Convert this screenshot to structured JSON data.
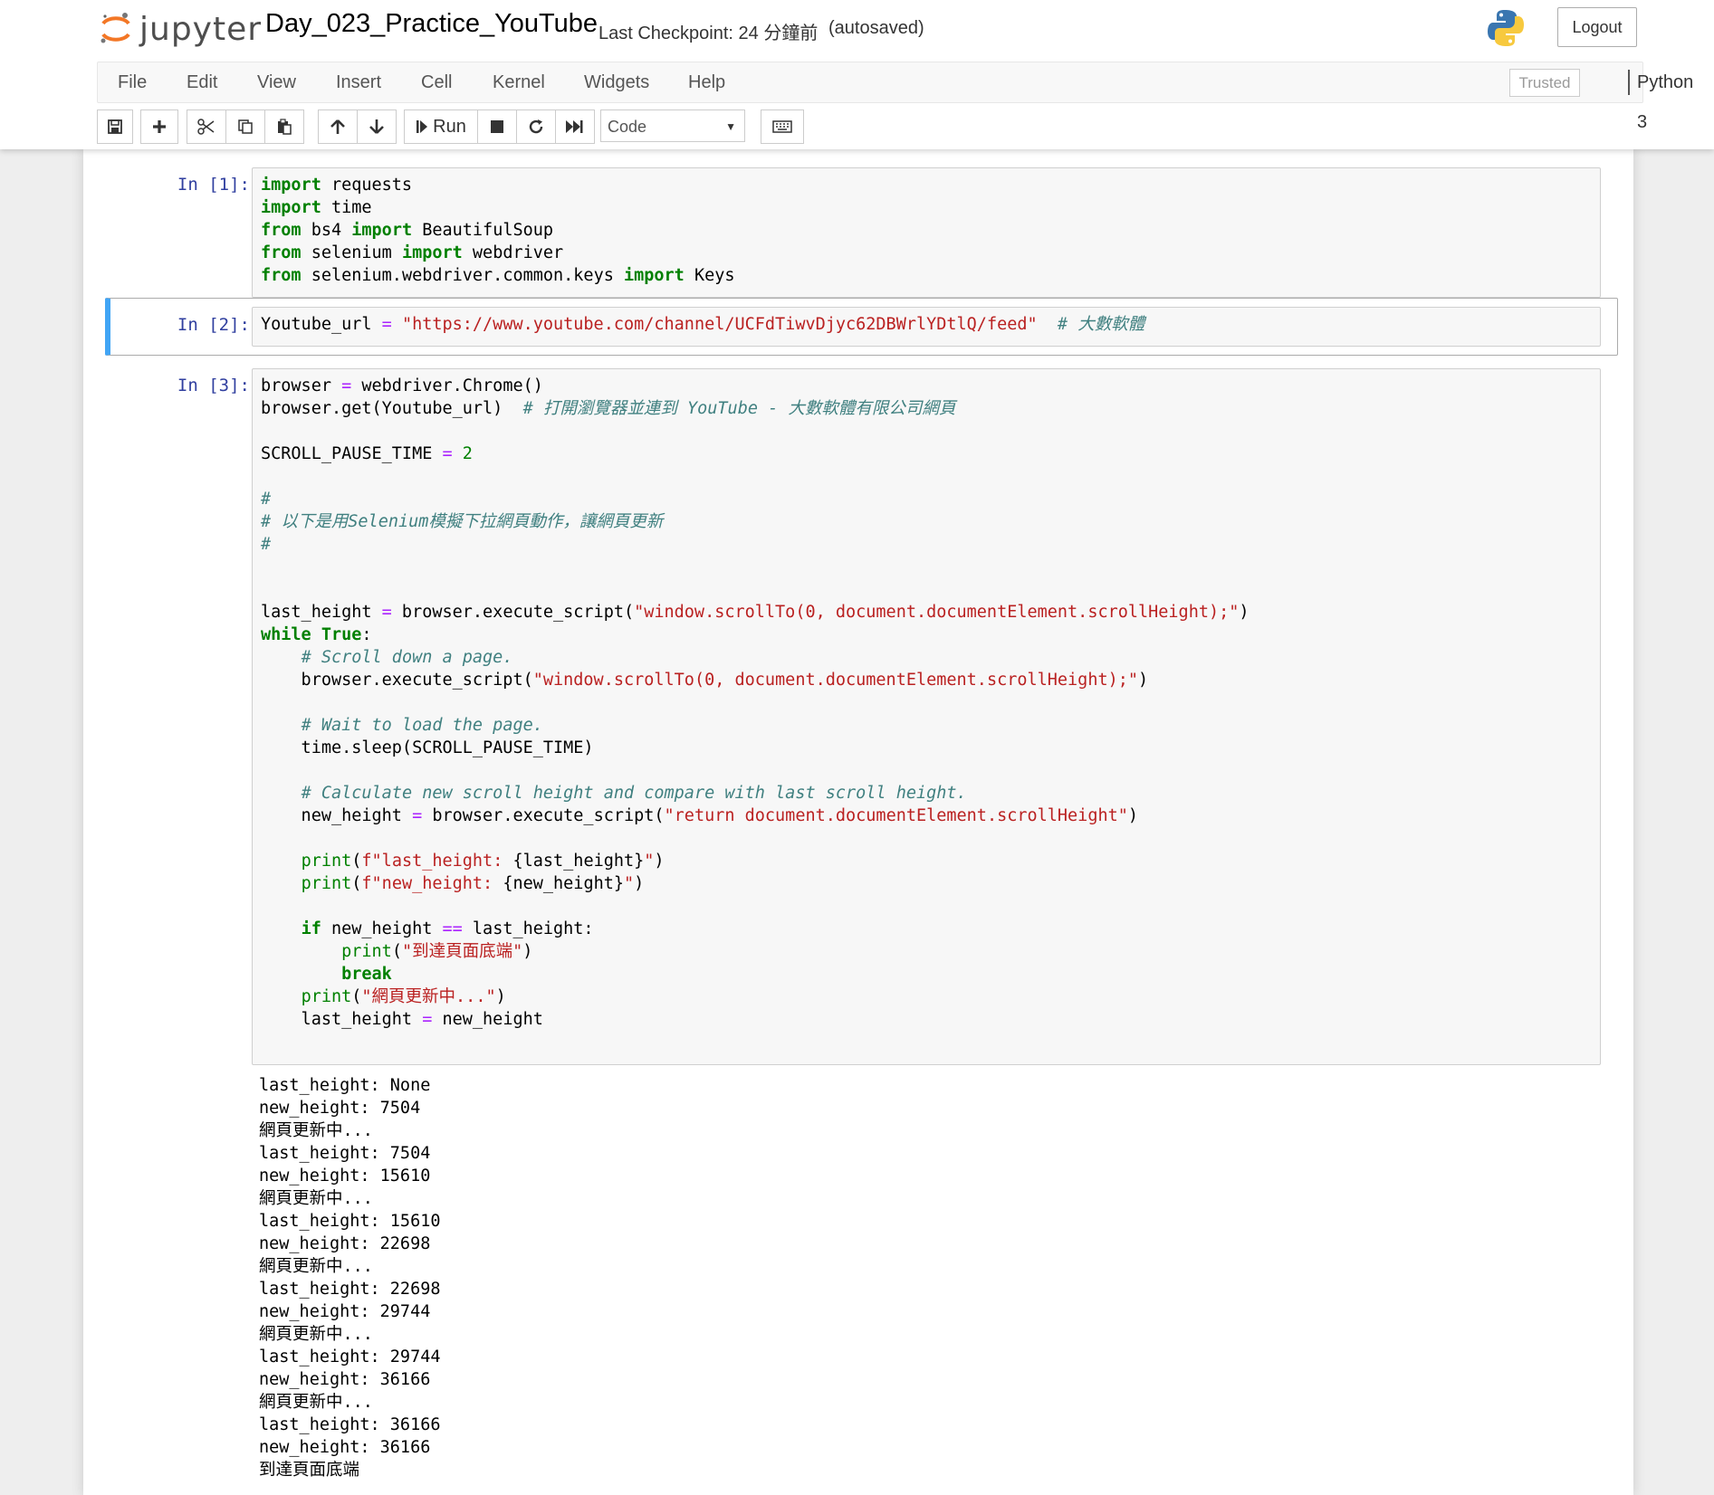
{
  "header": {
    "logo_text": "jupyter",
    "notebook_title": "Day_023_Practice_YouTube",
    "checkpoint": "Last Checkpoint: 24 分鐘前",
    "autosave": "(autosaved)",
    "logout_label": "Logout"
  },
  "menu": {
    "items": [
      "File",
      "Edit",
      "View",
      "Insert",
      "Cell",
      "Kernel",
      "Widgets",
      "Help"
    ],
    "trusted": "Trusted",
    "kernel_name": "Python 3"
  },
  "toolbar": {
    "run_label": "Run",
    "cell_type": "Code",
    "icons": [
      "save-icon",
      "plus-icon",
      "scissors-icon",
      "copy-icon",
      "paste-icon",
      "arrow-up-icon",
      "arrow-down-icon",
      "step-forward-icon",
      "stop-icon",
      "refresh-icon",
      "fast-forward-icon",
      "keyboard-icon"
    ]
  },
  "cells": [
    {
      "prompt": "In [1]:",
      "lines": [
        [
          [
            "kw",
            "import"
          ],
          [
            "",
            " requests"
          ]
        ],
        [
          [
            "kw",
            "import"
          ],
          [
            "",
            " time"
          ]
        ],
        [
          [
            "kw",
            "from"
          ],
          [
            "",
            " bs4 "
          ],
          [
            "kw",
            "import"
          ],
          [
            "",
            " BeautifulSoup"
          ]
        ],
        [
          [
            "kw",
            "from"
          ],
          [
            "",
            " selenium "
          ],
          [
            "kw",
            "import"
          ],
          [
            "",
            " webdriver"
          ]
        ],
        [
          [
            "kw",
            "from"
          ],
          [
            "",
            " selenium.webdriver.common.keys "
          ],
          [
            "kw",
            "import"
          ],
          [
            "",
            " Keys"
          ]
        ]
      ]
    },
    {
      "prompt": "In [2]:",
      "lines": [
        [
          [
            "",
            "Youtube_url "
          ],
          [
            "op",
            "="
          ],
          [
            "",
            " "
          ],
          [
            "str",
            "\"https://www.youtube.com/channel/UCFdTiwvDjyc62DBWrlYDtlQ/feed\""
          ],
          [
            "",
            "  "
          ],
          [
            "cm",
            "# 大數軟體"
          ]
        ]
      ]
    },
    {
      "prompt": "In [3]:",
      "lines": [
        [
          [
            "",
            "browser "
          ],
          [
            "op",
            "="
          ],
          [
            "",
            " webdriver.Chrome()"
          ]
        ],
        [
          [
            "",
            "browser.get(Youtube_url)  "
          ],
          [
            "cm",
            "# 打開瀏覽器並連到 YouTube - 大數軟體有限公司網頁"
          ]
        ],
        [],
        [
          [
            "",
            "SCROLL_PAUSE_TIME "
          ],
          [
            "op",
            "="
          ],
          [
            "",
            " "
          ],
          [
            "num",
            "2"
          ]
        ],
        [],
        [
          [
            "cm",
            "#"
          ]
        ],
        [
          [
            "cm",
            "# 以下是用Selenium模擬下拉網頁動作，讓網頁更新"
          ]
        ],
        [
          [
            "cm",
            "#"
          ]
        ],
        [],
        [],
        [
          [
            "",
            "last_height "
          ],
          [
            "op",
            "="
          ],
          [
            "",
            " browser.execute_script("
          ],
          [
            "str",
            "\"window.scrollTo(0, document.documentElement.scrollHeight);\""
          ],
          [
            "",
            ")"
          ]
        ],
        [
          [
            "kw",
            "while"
          ],
          [
            "",
            " "
          ],
          [
            "kw",
            "True"
          ],
          [
            "",
            ":"
          ]
        ],
        [
          [
            "",
            "    "
          ],
          [
            "cm",
            "# Scroll down a page."
          ]
        ],
        [
          [
            "",
            "    browser.execute_script("
          ],
          [
            "str",
            "\"window.scrollTo(0, document.documentElement.scrollHeight);\""
          ],
          [
            "",
            ")"
          ]
        ],
        [],
        [
          [
            "",
            "    "
          ],
          [
            "cm",
            "# Wait to load the page."
          ]
        ],
        [
          [
            "",
            "    time.sleep(SCROLL_PAUSE_TIME)"
          ]
        ],
        [],
        [
          [
            "",
            "    "
          ],
          [
            "cm",
            "# Calculate new scroll height and compare with last scroll height."
          ]
        ],
        [
          [
            "",
            "    new_height "
          ],
          [
            "op",
            "="
          ],
          [
            "",
            " browser.execute_script("
          ],
          [
            "str",
            "\"return document.documentElement.scrollHeight\""
          ],
          [
            "",
            ")"
          ]
        ],
        [],
        [
          [
            "",
            "    "
          ],
          [
            "bi",
            "print"
          ],
          [
            "",
            "("
          ],
          [
            "str",
            "f\"last_height: "
          ],
          [
            "",
            "{last_height}"
          ],
          [
            "str",
            "\""
          ],
          [
            "",
            ")"
          ]
        ],
        [
          [
            "",
            "    "
          ],
          [
            "bi",
            "print"
          ],
          [
            "",
            "("
          ],
          [
            "str",
            "f\"new_height: "
          ],
          [
            "",
            "{new_height}"
          ],
          [
            "str",
            "\""
          ],
          [
            "",
            ")"
          ]
        ],
        [],
        [
          [
            "",
            "    "
          ],
          [
            "kw",
            "if"
          ],
          [
            "",
            " new_height "
          ],
          [
            "op",
            "=="
          ],
          [
            "",
            " last_height:"
          ]
        ],
        [
          [
            "",
            "        "
          ],
          [
            "bi",
            "print"
          ],
          [
            "",
            "("
          ],
          [
            "str",
            "\"到達頁面底端\""
          ],
          [
            "",
            ")"
          ]
        ],
        [
          [
            "",
            "        "
          ],
          [
            "kw",
            "break"
          ]
        ],
        [
          [
            "",
            "    "
          ],
          [
            "bi",
            "print"
          ],
          [
            "",
            "("
          ],
          [
            "str",
            "\"網頁更新中...\""
          ],
          [
            "",
            ")"
          ]
        ],
        [
          [
            "",
            "    last_height "
          ],
          [
            "op",
            "="
          ],
          [
            "",
            " new_height"
          ]
        ]
      ],
      "output": [
        "last_height: None",
        "new_height: 7504",
        "網頁更新中...",
        "last_height: 7504",
        "new_height: 15610",
        "網頁更新中...",
        "last_height: 15610",
        "new_height: 22698",
        "網頁更新中...",
        "last_height: 22698",
        "new_height: 29744",
        "網頁更新中...",
        "last_height: 29744",
        "new_height: 36166",
        "網頁更新中...",
        "last_height: 36166",
        "new_height: 36166",
        "到達頁面底端"
      ]
    }
  ]
}
